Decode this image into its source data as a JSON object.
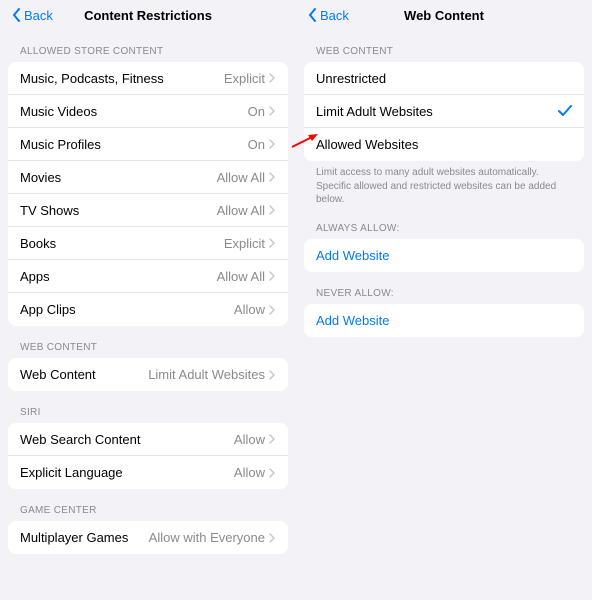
{
  "left": {
    "back": "Back",
    "title": "Content Restrictions",
    "store_header": "ALLOWED STORE CONTENT",
    "store_rows": [
      {
        "label": "Music, Podcasts, Fitness",
        "value": "Explicit"
      },
      {
        "label": "Music Videos",
        "value": "On"
      },
      {
        "label": "Music Profiles",
        "value": "On"
      },
      {
        "label": "Movies",
        "value": "Allow All"
      },
      {
        "label": "TV Shows",
        "value": "Allow All"
      },
      {
        "label": "Books",
        "value": "Explicit"
      },
      {
        "label": "Apps",
        "value": "Allow All"
      },
      {
        "label": "App Clips",
        "value": "Allow"
      }
    ],
    "web_header": "WEB CONTENT",
    "web_row": {
      "label": "Web Content",
      "value": "Limit Adult Websites"
    },
    "siri_header": "SIRI",
    "siri_rows": [
      {
        "label": "Web Search Content",
        "value": "Allow"
      },
      {
        "label": "Explicit Language",
        "value": "Allow"
      }
    ],
    "gc_header": "GAME CENTER",
    "gc_rows": [
      {
        "label": "Multiplayer Games",
        "value": "Allow with Everyone"
      }
    ]
  },
  "right": {
    "back": "Back",
    "title": "Web Content",
    "wc_header": "WEB CONTENT",
    "wc_rows": [
      {
        "label": "Unrestricted",
        "selected": false
      },
      {
        "label": "Limit Adult Websites",
        "selected": true
      },
      {
        "label": "Allowed Websites",
        "selected": false
      }
    ],
    "wc_footer": "Limit access to many adult websites automatically. Specific allowed and restricted websites can be added below.",
    "always_header": "ALWAYS ALLOW:",
    "never_header": "NEVER ALLOW:",
    "add_website": "Add Website"
  }
}
